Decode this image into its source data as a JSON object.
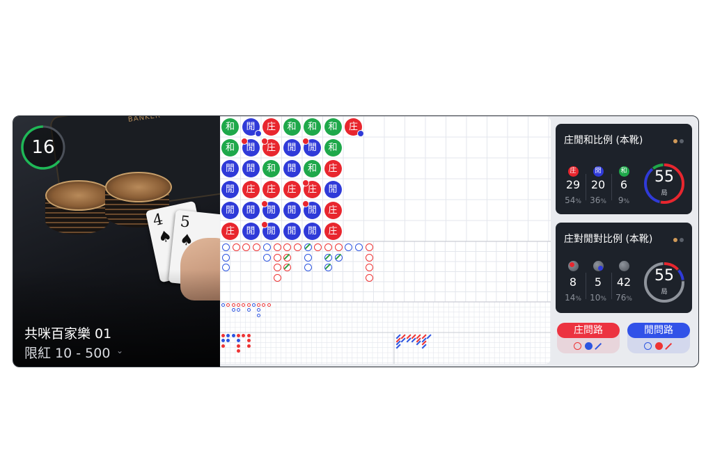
{
  "table": {
    "shoe_count": "16",
    "name": "共咪百家樂 01",
    "limit": "限紅 10 - 500",
    "felt_text": "BANKER",
    "card_ranks": [
      "4",
      "5"
    ]
  },
  "roadmap": {
    "bead_road": [
      [
        {
          "t": "T",
          "label": "和"
        },
        {
          "t": "T",
          "label": "和"
        },
        {
          "t": "P",
          "label": "閒"
        },
        {
          "t": "P",
          "label": "閒"
        },
        {
          "t": "P",
          "label": "閒"
        },
        {
          "t": "B",
          "label": "庄"
        }
      ],
      [
        {
          "t": "P",
          "label": "閒",
          "bp": "P-br"
        },
        {
          "t": "P",
          "label": "閒",
          "bp": "B-tl"
        },
        {
          "t": "P",
          "label": "閒"
        },
        {
          "t": "B",
          "label": "庄"
        },
        {
          "t": "P",
          "label": "閒"
        },
        {
          "t": "P",
          "label": "閒"
        }
      ],
      [
        {
          "t": "B",
          "label": "庄"
        },
        {
          "t": "B",
          "label": "庄",
          "bp": "B-tl"
        },
        {
          "t": "T",
          "label": "和"
        },
        {
          "t": "B",
          "label": "庄"
        },
        {
          "t": "P",
          "label": "閒",
          "bp": "B-tl"
        },
        {
          "t": "P",
          "label": "閒",
          "bp": "B-tl"
        }
      ],
      [
        {
          "t": "T",
          "label": "和"
        },
        {
          "t": "P",
          "label": "閒"
        },
        {
          "t": "P",
          "label": "閒"
        },
        {
          "t": "B",
          "label": "庄"
        },
        {
          "t": "P",
          "label": "閒"
        },
        {
          "t": "P",
          "label": "閒"
        }
      ],
      [
        {
          "t": "T",
          "label": "和"
        },
        {
          "t": "P",
          "label": "閒",
          "bp": "B-tl"
        },
        {
          "t": "T",
          "label": "和"
        },
        {
          "t": "B",
          "label": "庄",
          "bp": "B-tl"
        },
        {
          "t": "P",
          "label": "閒",
          "bp": "B-tl"
        },
        {
          "t": "P",
          "label": "閒"
        }
      ],
      [
        {
          "t": "T",
          "label": "和"
        },
        {
          "t": "T",
          "label": "和"
        },
        {
          "t": "B",
          "label": "庄"
        },
        {
          "t": "P",
          "label": "閒"
        },
        {
          "t": "B",
          "label": "庄"
        },
        {
          "t": "B",
          "label": "庄"
        }
      ],
      [
        {
          "t": "B",
          "label": "庄",
          "bp": "P-br"
        }
      ]
    ],
    "big_road": [
      [
        "b",
        "b",
        "b"
      ],
      [
        "r"
      ],
      [
        "r"
      ],
      [
        "r"
      ],
      [
        "b",
        "b"
      ],
      [
        "r",
        "r",
        "r",
        "r"
      ],
      [
        "r",
        "rs",
        "rs"
      ],
      [
        "r"
      ],
      [
        "bs",
        "b",
        "b"
      ],
      [
        "r"
      ],
      [
        "r",
        "bs",
        "bs"
      ],
      [
        "r",
        "bs"
      ],
      [
        "b"
      ],
      [
        "b"
      ],
      [
        "r",
        "r",
        "r",
        "r"
      ]
    ],
    "small_eye": [
      [
        "b"
      ],
      [
        "r"
      ],
      [
        "r",
        "b"
      ],
      [
        "r",
        "b"
      ],
      [
        "r"
      ],
      [
        "r",
        "b"
      ],
      [
        "b"
      ],
      [
        "r",
        "b",
        "b"
      ],
      [
        "r"
      ],
      [
        "r"
      ]
    ],
    "small_road": [
      [
        "r",
        "b",
        "r"
      ],
      [
        "b",
        "b"
      ],
      [
        "b"
      ],
      [
        "r",
        "b",
        "r",
        "r"
      ],
      [
        "r"
      ],
      [
        "r",
        "r",
        "r"
      ]
    ],
    "cockroach_road": [
      [
        "b",
        "r",
        "b",
        "b"
      ],
      [
        "r",
        "b"
      ],
      [
        "r",
        "b"
      ],
      [
        "r",
        "b"
      ],
      [
        "r",
        "r",
        "b"
      ],
      [
        "r",
        "b",
        "r",
        "b"
      ],
      [
        "b"
      ]
    ]
  },
  "stats_bpt": {
    "title": "庄閒和比例 (本靴)",
    "items": [
      {
        "badge": "庄",
        "color": "#e8262e",
        "count": "29",
        "pct": "54",
        "unit": "%"
      },
      {
        "badge": "閒",
        "color": "#2f3ad8",
        "count": "20",
        "pct": "36",
        "unit": "%"
      },
      {
        "badge": "和",
        "color": "#1ea84a",
        "count": "6",
        "pct": "9",
        "unit": "%"
      }
    ],
    "total": "55",
    "unit": "局",
    "ring_split": [
      0.54,
      0.36,
      0.1
    ]
  },
  "stats_pairs": {
    "title": "庄對閒對比例 (本靴)",
    "items": [
      {
        "count": "8",
        "pct": "14",
        "unit": "%",
        "mark": "#e8262e"
      },
      {
        "count": "5",
        "pct": "10",
        "unit": "%",
        "mark": "#2f3ad8"
      },
      {
        "count": "42",
        "pct": "76",
        "unit": "%",
        "mark": ""
      }
    ],
    "total": "55",
    "unit": "局",
    "ring_split": [
      0.14,
      0.1,
      0.76
    ]
  },
  "predict": {
    "banker_label": "庄問路",
    "player_label": "閒問路"
  },
  "colors": {
    "banker": "#e8262e",
    "player": "#2f3ad8",
    "tie": "#1ea84a",
    "grid": "#e3e6ec"
  }
}
